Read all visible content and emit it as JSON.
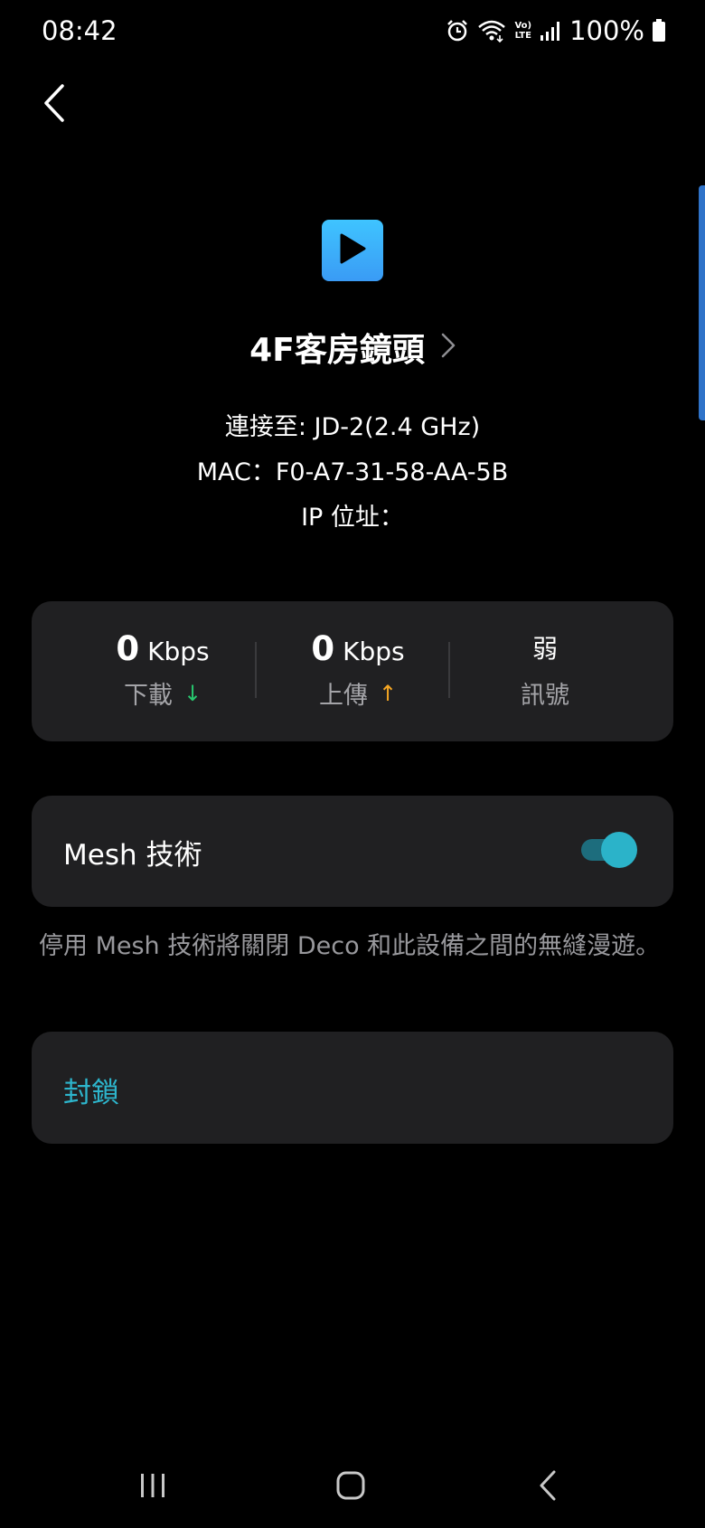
{
  "status_bar": {
    "time": "08:42",
    "lte_top": "Vo)",
    "lte_bottom": "LTE",
    "battery": "100%",
    "icons": [
      "alarm-icon",
      "wifi-icon",
      "volte-icon",
      "signal-icon",
      "battery-icon"
    ]
  },
  "header": {
    "back_icon": "back-arrow-icon"
  },
  "device": {
    "icon": "play-icon",
    "icon_color": "#3aaefa",
    "name": "4F客房鏡頭",
    "connected_to": "連接至: JD-2(2.4 GHz)",
    "mac": "MAC：F0-A7-31-58-AA-5B",
    "ip": "IP 位址："
  },
  "stats": {
    "download": {
      "value": "0",
      "unit": "Kbps",
      "label": "下載",
      "arrow": "↓"
    },
    "upload": {
      "value": "0",
      "unit": "Kbps",
      "label": "上傳",
      "arrow": "↑"
    },
    "signal": {
      "value": "弱",
      "label": "訊號"
    }
  },
  "mesh": {
    "label": "Mesh 技術",
    "enabled": true,
    "description": "停用 Mesh 技術將關閉 Deco 和此設備之間的無縫漫遊。"
  },
  "block": {
    "label": "封鎖",
    "color": "#2db5cc"
  },
  "nav_bar": {
    "icons": [
      "recent-apps-icon",
      "home-icon",
      "back-icon"
    ]
  }
}
